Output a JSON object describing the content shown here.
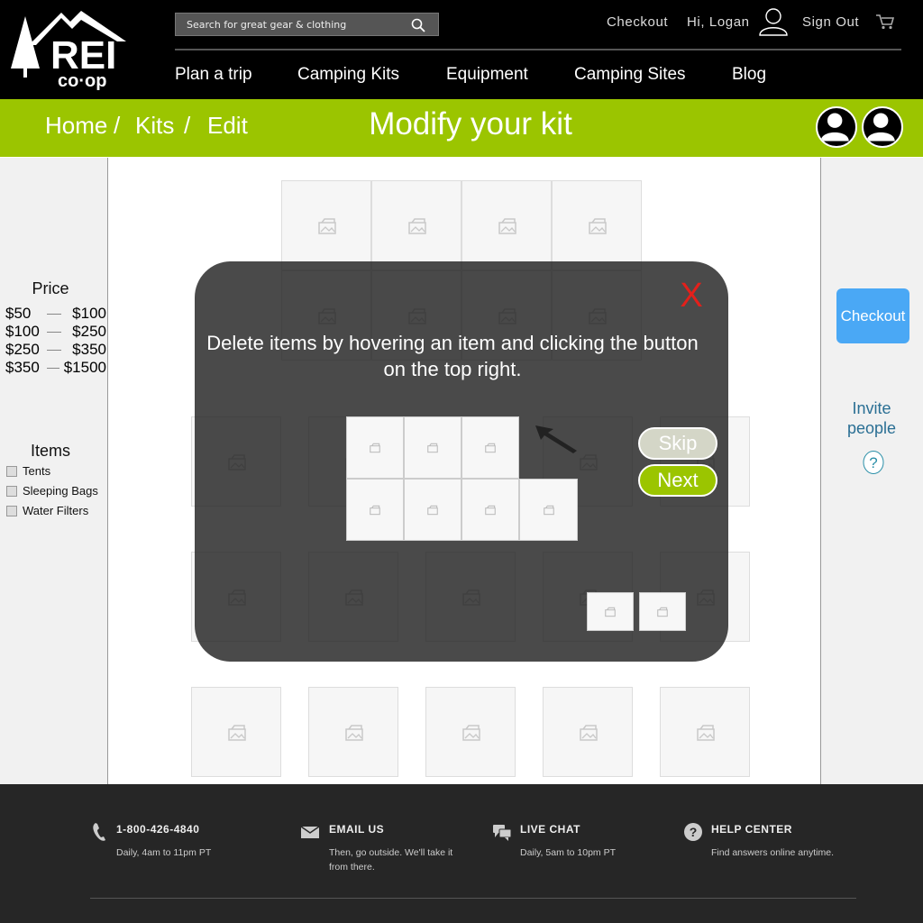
{
  "brand": {
    "name_primary": "REI",
    "name_secondary": "co·op"
  },
  "search": {
    "placeholder": "Search for great gear & clothing"
  },
  "account_nav": {
    "checkout": "Checkout",
    "greeting": "Hi, Logan",
    "sign_out": "Sign Out"
  },
  "main_nav": [
    {
      "label": "Plan a trip"
    },
    {
      "label": "Camping Kits"
    },
    {
      "label": "Equipment"
    },
    {
      "label": "Camping Sites"
    },
    {
      "label": "Blog"
    }
  ],
  "breadcrumb": [
    {
      "label": "Home"
    },
    {
      "label": "Kits"
    },
    {
      "label": "Edit"
    }
  ],
  "breadcrumb_separator": "/",
  "page_title": "Modify your kit",
  "filters": {
    "price_heading": "Price",
    "price_ranges": [
      {
        "low": "$50",
        "high": "$100"
      },
      {
        "low": "$100",
        "high": "$250"
      },
      {
        "low": "$250",
        "high": "$350"
      },
      {
        "low": "$350",
        "high": "$1500"
      }
    ],
    "items_heading": "Items",
    "items": [
      {
        "label": "Tents",
        "checked": false
      },
      {
        "label": "Sleeping Bags",
        "checked": false
      },
      {
        "label": "Water Filters",
        "checked": false
      }
    ]
  },
  "right_panel": {
    "checkout": "Checkout",
    "invite": "Invite people",
    "help": "?"
  },
  "tutorial": {
    "close": "X",
    "instruction": "Delete items by hovering an item and clicking the button on the top right.",
    "skip": "Skip",
    "next": "Next"
  },
  "footer": {
    "contacts": [
      {
        "icon": "phone-icon",
        "title": "1-800-426-4840",
        "text": "Daily, 4am to 11pm PT"
      },
      {
        "icon": "mail-icon",
        "title": "EMAIL US",
        "text": "Then, go outside. We'll take it from there."
      },
      {
        "icon": "chat-icon",
        "title": "LIVE CHAT",
        "text": "Daily, 5am to 10pm PT"
      },
      {
        "icon": "help-icon",
        "title": "HELP CENTER",
        "text": "Find answers online anytime."
      }
    ]
  },
  "colors": {
    "header_bg": "#000000",
    "accent_green": "#9bc500",
    "checkout_blue": "#4aa8f5",
    "close_red": "#e3201b",
    "footer_bg": "#262626"
  }
}
